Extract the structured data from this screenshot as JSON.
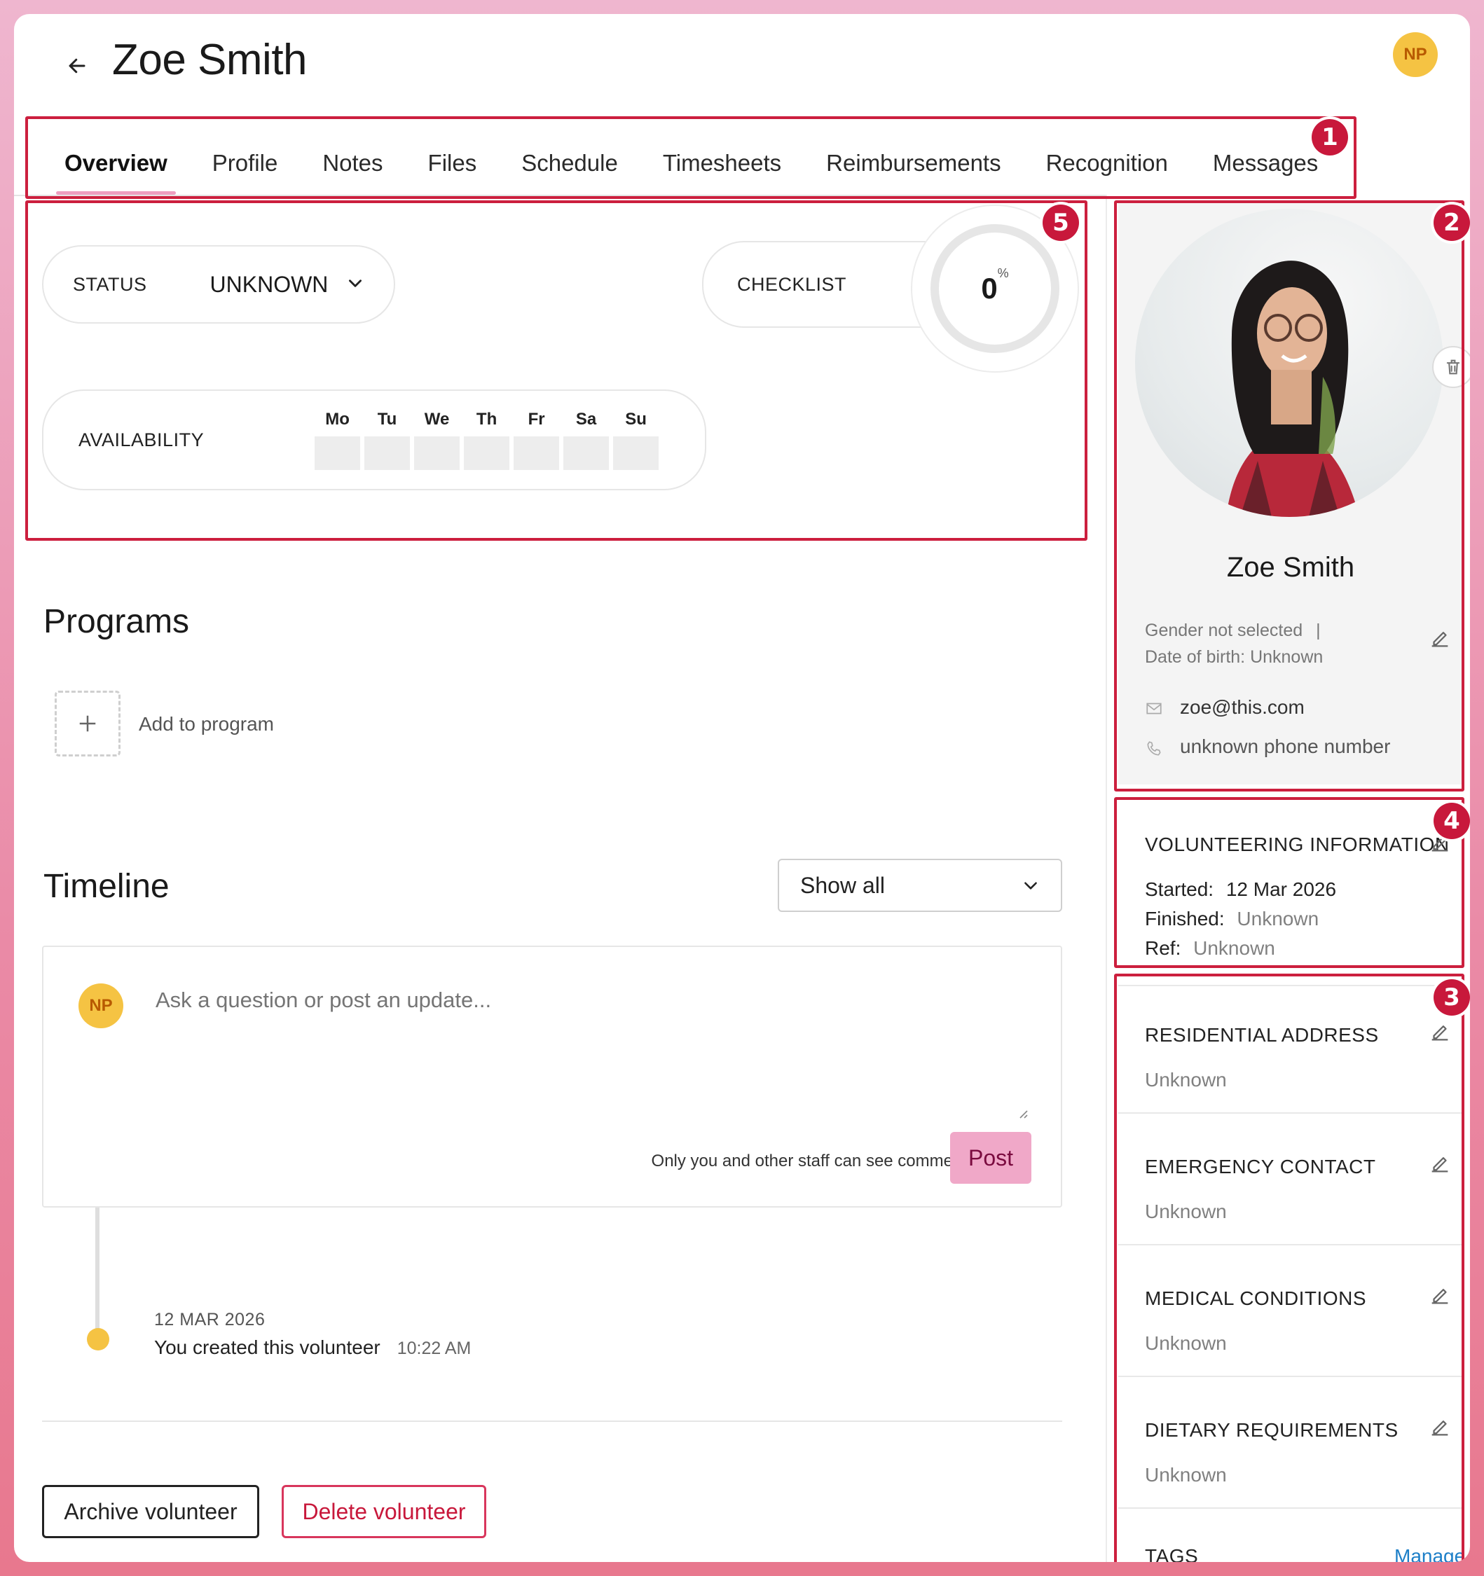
{
  "header": {
    "title": "Zoe Smith",
    "user_initials": "NP"
  },
  "tabs": [
    {
      "label": "Overview",
      "active": true
    },
    {
      "label": "Profile"
    },
    {
      "label": "Notes"
    },
    {
      "label": "Files"
    },
    {
      "label": "Schedule"
    },
    {
      "label": "Timesheets"
    },
    {
      "label": "Reimbursements"
    },
    {
      "label": "Recognition"
    },
    {
      "label": "Messages"
    }
  ],
  "markers": [
    "1",
    "2",
    "3",
    "4",
    "5"
  ],
  "status": {
    "label": "STATUS",
    "value": "UNKNOWN"
  },
  "checklist": {
    "label": "CHECKLIST",
    "value": "0",
    "unit": "%",
    "progress": 0
  },
  "availability": {
    "label": "AVAILABILITY",
    "days": [
      "Mo",
      "Tu",
      "We",
      "Th",
      "Fr",
      "Sa",
      "Su"
    ]
  },
  "programs": {
    "title": "Programs",
    "add_label": "Add to program"
  },
  "timeline": {
    "title": "Timeline",
    "filter": "Show all",
    "composer": {
      "placeholder": "Ask a question or post an update...",
      "privacy_note": "Only you and other staff can see comments",
      "post_label": "Post"
    },
    "events": [
      {
        "date": "12 MAR 2026",
        "text": "You created this volunteer",
        "time": "10:22 AM"
      }
    ]
  },
  "actions": {
    "archive": "Archive volunteer",
    "delete": "Delete volunteer"
  },
  "profile": {
    "name": "Zoe Smith",
    "gender": "Gender not selected",
    "separator": "|",
    "dob": "Date of birth: Unknown",
    "email": "zoe@this.com",
    "phone": "unknown phone number"
  },
  "volunteering": {
    "title": "VOLUNTEERING INFORMATION",
    "started_label": "Started:",
    "started_value": "12 Mar 2026",
    "finished_label": "Finished:",
    "finished_value": "Unknown",
    "ref_label": "Ref:",
    "ref_value": "Unknown"
  },
  "details": [
    {
      "title": "RESIDENTIAL ADDRESS",
      "value": "Unknown"
    },
    {
      "title": "EMERGENCY CONTACT",
      "value": "Unknown"
    },
    {
      "title": "MEDICAL CONDITIONS",
      "value": "Unknown"
    },
    {
      "title": "DIETARY REQUIREMENTS",
      "value": "Unknown"
    }
  ],
  "tags": {
    "title": "TAGS",
    "manage_label": "Manage"
  },
  "colors": {
    "accent_pink": "#ee9fc0",
    "annotation_red": "#cc1f3e",
    "avatar_yellow": "#f5c343",
    "delete_red": "#c8183b",
    "link_blue": "#1d7fc8"
  }
}
